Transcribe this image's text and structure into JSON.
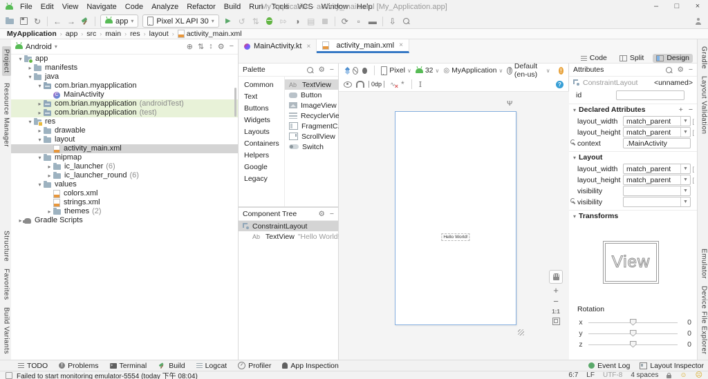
{
  "titlebar": {
    "title": "My Application - activity_main.xml [My_Application.app]",
    "menus": [
      "File",
      "Edit",
      "View",
      "Navigate",
      "Code",
      "Analyze",
      "Refactor",
      "Build",
      "Run",
      "Tools",
      "VCS",
      "Window",
      "Help"
    ],
    "window_controls": [
      "minimize",
      "maximize",
      "close"
    ]
  },
  "toolbar": {
    "run_config": "app",
    "device": "Pixel XL API 30",
    "icons_left": [
      "open-folder",
      "save-all",
      "sync"
    ],
    "icons_nav": [
      "back-arrow",
      "forward-arrow",
      "build-hammer"
    ],
    "icons_run": [
      "run",
      "apply-changes",
      "apply-code-changes",
      "debug",
      "attach-debugger",
      "profile",
      "coverage",
      "stop"
    ],
    "icons_right": [
      "sync-project-gradle",
      "device-manager",
      "avd-manager",
      "sdk-manager",
      "search-everywhere",
      "user-avatar"
    ]
  },
  "breadcrumb": {
    "items": [
      "MyApplication",
      "app",
      "src",
      "main",
      "res",
      "layout"
    ],
    "file": "activity_main.xml"
  },
  "stripes": {
    "left_top": [
      "Project",
      "Resource Manager"
    ],
    "left_bottom": [
      "Structure",
      "Favorites",
      "Build Variants"
    ],
    "right_top": [
      "Gradle",
      "Layout Validation"
    ],
    "right_bottom": [
      "Emulator",
      "Device File Explorer"
    ]
  },
  "project": {
    "view_selector": "Android",
    "header_icons": [
      "locate",
      "expand-all",
      "collapse-all",
      "settings-gear",
      "hide"
    ],
    "tree": [
      {
        "label": "app",
        "depth": 0,
        "chevron": "open",
        "icon": "module"
      },
      {
        "label": "manifests",
        "depth": 1,
        "chevron": "closed",
        "icon": "folder"
      },
      {
        "label": "java",
        "depth": 1,
        "chevron": "open",
        "icon": "folder"
      },
      {
        "label": "com.brian.myapplication",
        "depth": 2,
        "chevron": "open",
        "icon": "package"
      },
      {
        "label": "MainActivity",
        "depth": 3,
        "chevron": "none",
        "icon": "kotlin"
      },
      {
        "label": "com.brian.myapplication",
        "suffix": "(androidTest)",
        "depth": 2,
        "chevron": "closed",
        "icon": "package",
        "bg": "green"
      },
      {
        "label": "com.brian.myapplication",
        "suffix": "(test)",
        "depth": 2,
        "chevron": "closed",
        "icon": "package",
        "bg": "green"
      },
      {
        "label": "res",
        "depth": 1,
        "chevron": "open",
        "icon": "res"
      },
      {
        "label": "drawable",
        "depth": 2,
        "chevron": "closed",
        "icon": "folder"
      },
      {
        "label": "layout",
        "depth": 2,
        "chevron": "open",
        "icon": "folder"
      },
      {
        "label": "activity_main.xml",
        "depth": 3,
        "chevron": "none",
        "icon": "xml",
        "bg": "selected"
      },
      {
        "label": "mipmap",
        "depth": 2,
        "chevron": "open",
        "icon": "folder"
      },
      {
        "label": "ic_launcher",
        "suffix": "(6)",
        "depth": 3,
        "chevron": "closed",
        "icon": "folder"
      },
      {
        "label": "ic_launcher_round",
        "suffix": "(6)",
        "depth": 3,
        "chevron": "closed",
        "icon": "folder"
      },
      {
        "label": "values",
        "depth": 2,
        "chevron": "open",
        "icon": "folder"
      },
      {
        "label": "colors.xml",
        "depth": 3,
        "chevron": "none",
        "icon": "xml"
      },
      {
        "label": "strings.xml",
        "depth": 3,
        "chevron": "none",
        "icon": "xml"
      },
      {
        "label": "themes",
        "suffix": "(2)",
        "depth": 3,
        "chevron": "closed",
        "icon": "folder"
      },
      {
        "label": "Gradle Scripts",
        "depth": 0,
        "chevron": "closed",
        "icon": "gradle"
      }
    ]
  },
  "editor": {
    "tabs": [
      {
        "label": "MainActivity.kt",
        "icon": "kotlin-file",
        "active": false
      },
      {
        "label": "activity_main.xml",
        "icon": "xml-file",
        "active": true
      }
    ],
    "modes": [
      {
        "label": "Code",
        "active": false
      },
      {
        "label": "Split",
        "active": false
      },
      {
        "label": "Design",
        "active": true
      }
    ]
  },
  "palette": {
    "title": "Palette",
    "categories": [
      "Common",
      "Text",
      "Buttons",
      "Widgets",
      "Layouts",
      "Containers",
      "Helpers",
      "Google",
      "Legacy"
    ],
    "active_category": "Common",
    "items": [
      {
        "label": "TextView",
        "icon": "Ab",
        "selected": true
      },
      {
        "label": "Button",
        "icon": "button",
        "selected": false
      },
      {
        "label": "ImageView",
        "icon": "image",
        "selected": false
      },
      {
        "label": "RecyclerView",
        "icon": "list",
        "selected": false
      },
      {
        "label": "FragmentC...",
        "icon": "fragment",
        "selected": false
      },
      {
        "label": "ScrollView",
        "icon": "scroll",
        "selected": false
      },
      {
        "label": "Switch",
        "icon": "switch",
        "selected": false
      }
    ]
  },
  "component_tree": {
    "title": "Component Tree",
    "items": [
      {
        "label": "ConstraintLayout",
        "icon": "constraint-layout",
        "selected": true,
        "depth": 0,
        "note": ""
      },
      {
        "label": "TextView",
        "icon": "Ab",
        "selected": false,
        "depth": 1,
        "note": "\"Hello World!\""
      }
    ]
  },
  "design": {
    "toolbar1": {
      "device_label": "Pixel",
      "api_label": "32",
      "theme_label": "MyApplication",
      "locale_label": "Default (en-us)"
    },
    "toolbar2": {
      "margin_label": "0dp"
    },
    "canvas_text": "Hello World!",
    "zoom": {
      "in": "+",
      "out": "−",
      "ratio": "1:1"
    }
  },
  "attributes": {
    "title": "Attributes",
    "component": "ConstraintLayout",
    "unnamed": "<unnamed>",
    "id_label": "id",
    "id_value": "",
    "sections": {
      "declared": {
        "title": "Declared Attributes",
        "rows": [
          {
            "label": "layout_width",
            "value": "match_parent",
            "control": "dropdown",
            "wrench": false,
            "bracket": true
          },
          {
            "label": "layout_height",
            "value": "match_parent",
            "control": "dropdown",
            "wrench": false,
            "bracket": true
          },
          {
            "label": "context",
            "value": ".MainActivity",
            "control": "text",
            "wrench": true,
            "bracket": false
          }
        ]
      },
      "layout": {
        "title": "Layout",
        "rows": [
          {
            "label": "layout_width",
            "value": "match_parent",
            "control": "dropdown",
            "wrench": false,
            "bracket": true
          },
          {
            "label": "layout_height",
            "value": "match_parent",
            "control": "dropdown",
            "wrench": false,
            "bracket": true
          },
          {
            "label": "visibility",
            "value": "",
            "control": "dropdown",
            "wrench": false,
            "bracket": false
          },
          {
            "label": "visibility",
            "value": "",
            "control": "dropdown",
            "wrench": true,
            "bracket": false
          }
        ]
      },
      "transforms": {
        "title": "Transforms",
        "preview_text": "View",
        "rotation_label": "Rotation",
        "sliders": [
          {
            "axis": "x",
            "value": "0"
          },
          {
            "axis": "y",
            "value": "0"
          },
          {
            "axis": "z",
            "value": "0"
          }
        ]
      }
    }
  },
  "bottom_bar": {
    "left": [
      {
        "label": "TODO",
        "icon": "todo"
      },
      {
        "label": "Problems",
        "icon": "problems"
      },
      {
        "label": "Terminal",
        "icon": "terminal"
      },
      {
        "label": "Build",
        "icon": "build-hammer"
      },
      {
        "label": "Logcat",
        "icon": "logcat"
      },
      {
        "label": "Profiler",
        "icon": "profiler"
      },
      {
        "label": "App Inspection",
        "icon": "app-inspection"
      }
    ],
    "right": [
      {
        "label": "Event Log",
        "icon": "event-log"
      },
      {
        "label": "Layout Inspector",
        "icon": "layout-inspector"
      }
    ]
  },
  "status_bar": {
    "message": "Failed to start monitoring emulator-5554 (today 下午 08:04)",
    "caret_position": "6:7",
    "line_ending": "LF",
    "encoding": "UTF-8",
    "indent": "4 spaces"
  }
}
